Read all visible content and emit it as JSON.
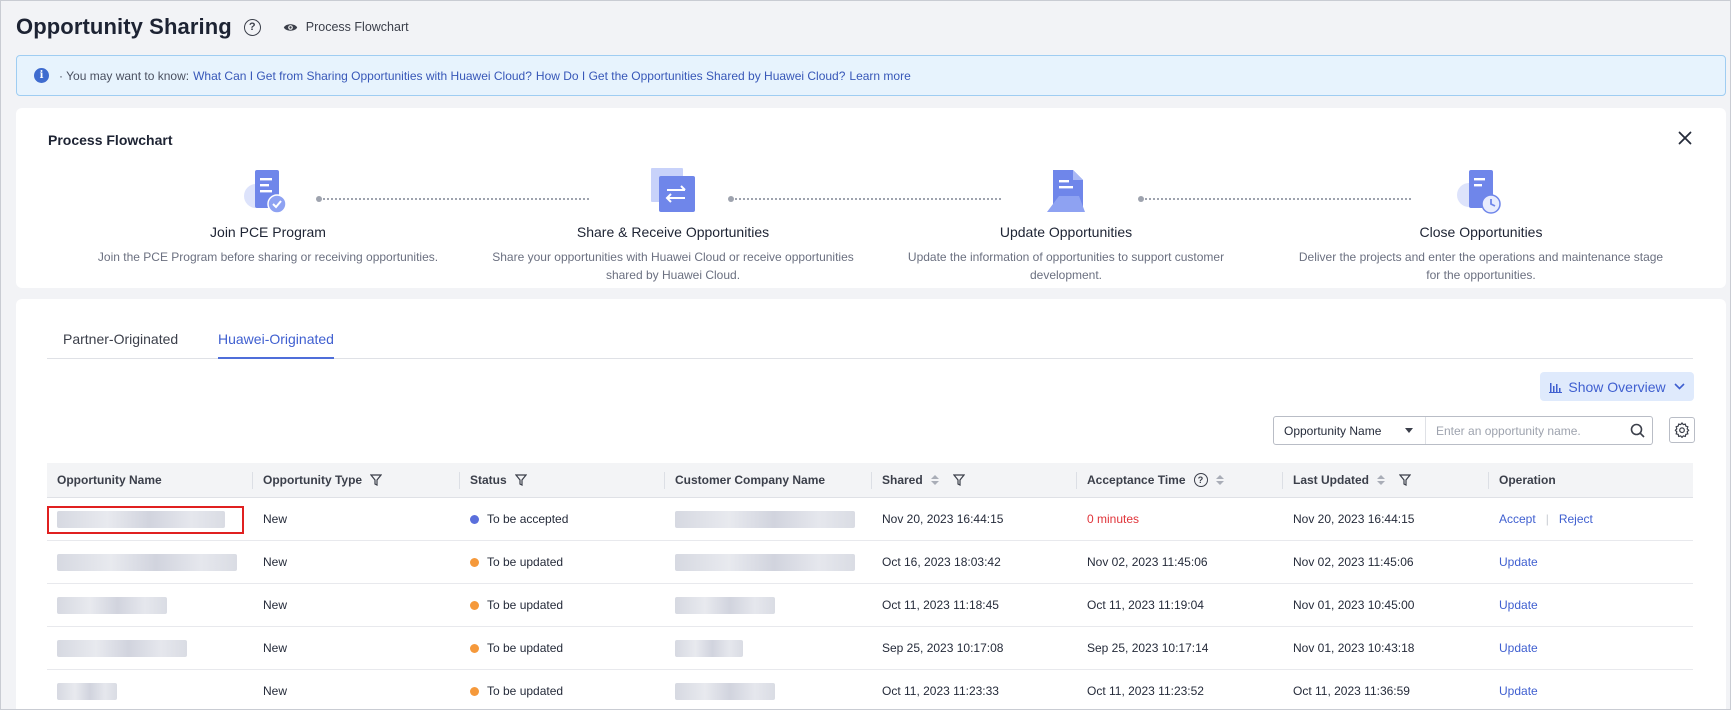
{
  "header": {
    "title": "Opportunity Sharing",
    "help_glyph": "?",
    "flow_link_label": "Process Flowchart"
  },
  "notice": {
    "prefix": "· You may want to know:",
    "links": [
      "What Can I Get from Sharing Opportunities with Huawei Cloud?",
      "How Do I Get the Opportunities Shared by Huawei Cloud?",
      "Learn more"
    ]
  },
  "flowchart": {
    "title": "Process Flowchart",
    "steps": [
      {
        "title": "Join PCE Program",
        "desc": "Join the PCE Program before sharing or receiving opportunities.",
        "icon": "document-check-icon"
      },
      {
        "title": "Share & Receive Opportunities",
        "desc": "Share your opportunities with Huawei Cloud or receive opportunities shared by Huawei Cloud.",
        "icon": "exchange-icon"
      },
      {
        "title": "Update Opportunities",
        "desc": "Update the information of opportunities to support customer development.",
        "icon": "document-edit-icon"
      },
      {
        "title": "Close Opportunities",
        "desc": "Deliver the projects and enter the operations and maintenance stage for the opportunities.",
        "icon": "document-clock-icon"
      }
    ]
  },
  "tabs": [
    {
      "label": "Partner-Originated",
      "active": false
    },
    {
      "label": "Huawei-Originated",
      "active": true
    }
  ],
  "toolbar": {
    "overview_label": "Show Overview",
    "search_field": "Opportunity Name",
    "search_placeholder": "Enter an opportunity name."
  },
  "table": {
    "columns": [
      "Opportunity Name",
      "Opportunity Type",
      "Status",
      "Customer Company Name",
      "Shared",
      "Acceptance Time",
      "Last Updated",
      "Operation"
    ],
    "rows": [
      {
        "type": "New",
        "status": "To be accepted",
        "status_color": "#5a6fdc",
        "shared": "Nov 20, 2023 16:44:15",
        "acceptance": "0 minutes",
        "updated": "Nov 20, 2023 16:44:15",
        "ops": [
          "Accept",
          "Reject"
        ]
      },
      {
        "type": "New",
        "status": "To be updated",
        "status_color": "#f5993b",
        "shared": "Oct 16, 2023 18:03:42",
        "acceptance": "Nov 02, 2023 11:45:06",
        "updated": "Nov 02, 2023 11:45:06",
        "ops": [
          "Update"
        ]
      },
      {
        "type": "New",
        "status": "To be updated",
        "status_color": "#f5993b",
        "shared": "Oct 11, 2023 11:18:45",
        "acceptance": "Oct 11, 2023 11:19:04",
        "updated": "Nov 01, 2023 10:45:00",
        "ops": [
          "Update"
        ]
      },
      {
        "type": "New",
        "status": "To be updated",
        "status_color": "#f5993b",
        "shared": "Sep 25, 2023 10:17:08",
        "acceptance": "Sep 25, 2023 10:17:14",
        "updated": "Nov 01, 2023 10:43:18",
        "ops": [
          "Update"
        ]
      },
      {
        "type": "New",
        "status": "To be updated",
        "status_color": "#f5993b",
        "shared": "Oct 11, 2023 11:23:33",
        "acceptance": "Oct 11, 2023 11:23:52",
        "updated": "Oct 11, 2023 11:36:59",
        "ops": [
          "Update"
        ]
      }
    ]
  },
  "colors": {
    "accent": "#3f5fd0",
    "danger": "#e0343a",
    "highlight_border": "#e02020"
  }
}
